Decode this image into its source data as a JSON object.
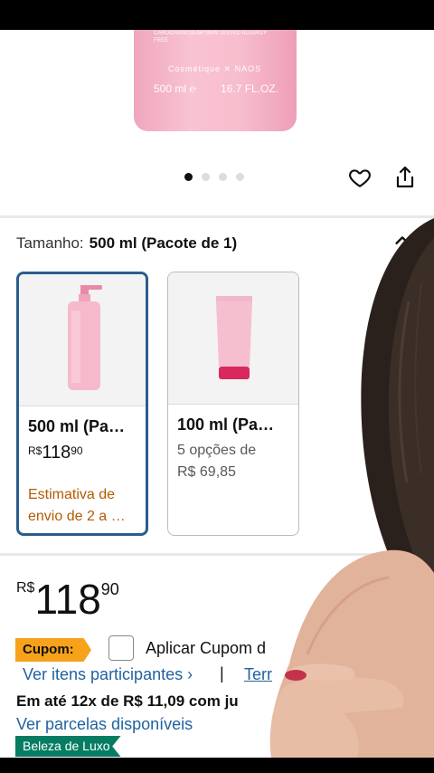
{
  "product_image": {
    "small_text": "CARDIOVASCULAR SKIN TESTED ALLERGY FREE",
    "brand_line": "Cosmétique",
    "brand_mark": "NAOS",
    "volume": "500 ml ℮",
    "volume_oz": "16.7 FL.OZ."
  },
  "carousel": {
    "total": 4,
    "active_index": 0
  },
  "size": {
    "label": "Tamanho:",
    "value": "500 ml (Pacote de 1)"
  },
  "options": [
    {
      "title": "500 ml (Pa…",
      "currency": "R$",
      "price_int": "118",
      "price_dec": "90",
      "shipping": "Estimativa de envio de 2 a …",
      "selected": true
    },
    {
      "title": "100 ml (Pa…",
      "offers": "5 opções de",
      "offers_price": "R$ 69,85",
      "selected": false
    }
  ],
  "price": {
    "currency": "R$",
    "int": "118",
    "dec": "90"
  },
  "coupon": {
    "badge": "Cupom:",
    "apply": "Aplicar Cupom d"
  },
  "links": {
    "see_items": "Ver itens participantes ›",
    "separator": "|",
    "terms": "Terr"
  },
  "installments": "Em até 12x de R$ 11,09 com ju",
  "see_parcels": "Ver parcelas disponíveis",
  "luxury_badge": "Beleza de Luxo",
  "colors": {
    "link": "#2162a1",
    "coupon": "#f7a21a",
    "luxury": "#067d62",
    "selected_border": "#2a5d8e",
    "shipping": "#b35b00"
  }
}
